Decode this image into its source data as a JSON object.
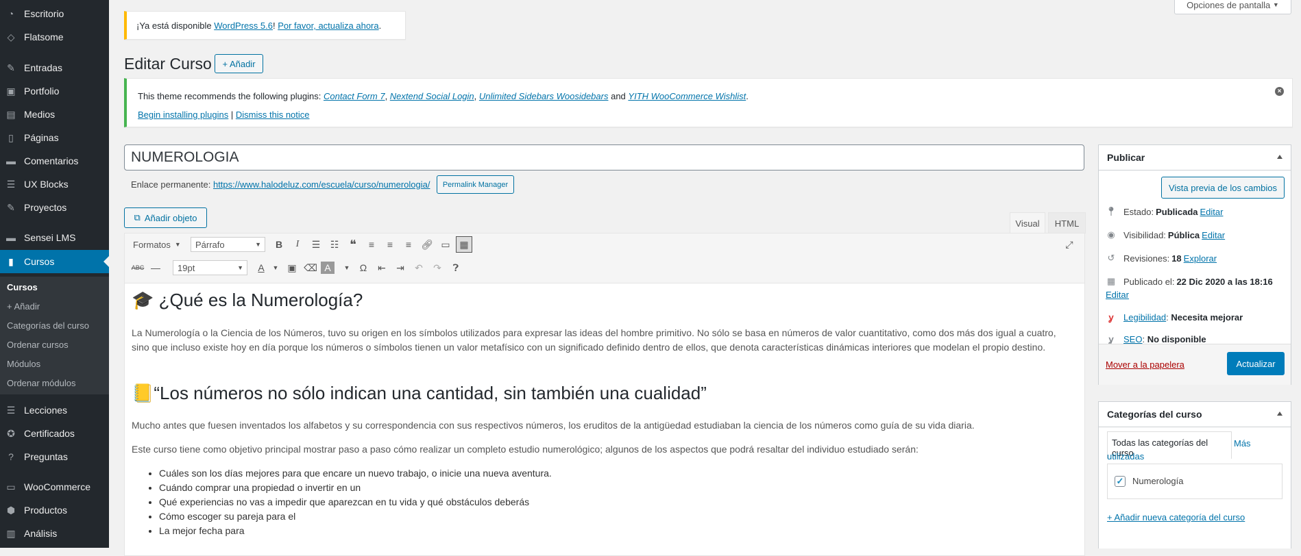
{
  "sidebar": {
    "items": [
      {
        "label": "Escritorio",
        "icon": "dashboard-icon"
      },
      {
        "label": "Flatsome",
        "icon": "flatsome-icon"
      },
      {
        "label": "Entradas",
        "icon": "pin-icon"
      },
      {
        "label": "Portfolio",
        "icon": "portfolio-icon"
      },
      {
        "label": "Medios",
        "icon": "media-icon"
      },
      {
        "label": "Páginas",
        "icon": "pages-icon"
      },
      {
        "label": "Comentarios",
        "icon": "comments-icon"
      },
      {
        "label": "UX Blocks",
        "icon": "blocks-icon"
      },
      {
        "label": "Proyectos",
        "icon": "pin-icon"
      },
      {
        "label": "Sensei LMS",
        "icon": "sensei-icon"
      },
      {
        "label": "Cursos",
        "icon": "book-icon"
      },
      {
        "label": "Lecciones",
        "icon": "list-icon"
      },
      {
        "label": "Certificados",
        "icon": "certificate-icon"
      },
      {
        "label": "Preguntas",
        "icon": "question-icon"
      },
      {
        "label": "WooCommerce",
        "icon": "woo-icon"
      },
      {
        "label": "Productos",
        "icon": "products-icon"
      },
      {
        "label": "Análisis",
        "icon": "analytics-icon"
      }
    ],
    "submenu": [
      "Cursos",
      "+ Añadir",
      "Categorías del curso",
      "Ordenar cursos",
      "Módulos",
      "Ordenar módulos"
    ]
  },
  "screen_options": "Opciones de pantalla",
  "update_notice": {
    "prefix": "¡Ya está disponible ",
    "version_link": "WordPress 5.6",
    "sep": "! ",
    "update_link": "Por favor, actualiza ahora",
    "suffix": "."
  },
  "page": {
    "title": "Editar Curso",
    "add_new": "+ Añadir"
  },
  "plugin_notice": {
    "prefix": "This theme recommends the following plugins: ",
    "p1": "Contact Form 7",
    "p2": "Nextend Social Login",
    "p3": "Unlimited Sidebars Woosidebars",
    "and": " and ",
    "p4": "YITH WooCommerce Wishlist",
    "begin": "Begin installing plugins",
    "pipe": " | ",
    "dismiss": "Dismiss this notice"
  },
  "post": {
    "title": "NUMEROLOGIA",
    "permalink_label": "Enlace permanente: ",
    "permalink_url": "https://www.halodeluz.com/escuela/curso/numerologia/",
    "permalink_button": "Permalink Manager"
  },
  "editor": {
    "add_media": "Añadir objeto",
    "tab_visual": "Visual",
    "tab_html": "HTML",
    "formats": "Formatos",
    "paragraph": "Párrafo",
    "font_size": "19pt",
    "h1_emoji": "🎓",
    "h1": "¿Qué es la Numerología?",
    "p1": "La Numerología o la Ciencia de los Números, tuvo su origen en los símbolos utilizados para expresar las ideas del hombre primitivo. No sólo se basa en números de valor cuantitativo, como dos más dos igual a cuatro, sino que incluso existe hoy en día porque los números o símbolos tienen un valor metafísico con un significado definido dentro de ellos, que denota características dinámicas interiores que modelan el propio destino.",
    "h2_emoji": "📒",
    "h2": "“Los números no sólo indican una cantidad, sin también una cualidad”",
    "p2": "Mucho antes que fuesen inventados los alfabetos y su correspondencia con sus respectivos números, los eruditos de la antigüedad estudiaban la ciencia de los números como guía de su vida diaria.",
    "p3": "Este curso tiene como objetivo principal mostrar paso a paso cómo realizar un completo estudio numerológico; algunos de los aspectos que podrá resaltar del individuo estudiado serán:",
    "list": [
      "Cuáles son los días mejores para que encare un nuevo trabajo, o inicie una nueva aventura.",
      "Cuándo comprar una propiedad o invertir en un",
      "Qué experiencias no vas a impedir que aparezcan en tu vida y qué obstáculos deberás",
      "Cómo escoger su pareja para el",
      "La mejor fecha para"
    ]
  },
  "publish": {
    "title": "Publicar",
    "preview": "Vista previa de los cambios",
    "status_label": "Estado:",
    "status_value": "Publicada",
    "edit": "Editar",
    "visibility_label": "Visibilidad:",
    "visibility_value": "Pública",
    "revisions_label": "Revisiones:",
    "revisions_value": "18",
    "explore": "Explorar",
    "published_label": "Publicado el:",
    "published_value": "22 Dic 2020 a las 18:16",
    "readability_link": "Legibilidad",
    "readability_value": "Necesita mejorar",
    "seo_link": "SEO",
    "seo_value": "No disponible",
    "trash": "Mover a la papelera",
    "update": "Actualizar"
  },
  "categories": {
    "title": "Categorías del curso",
    "tab_all": "Todas las categorías del curso",
    "tab_used": "Más utilizadas",
    "item": "Numerología",
    "add": "+ Añadir nueva categoría del curso"
  }
}
